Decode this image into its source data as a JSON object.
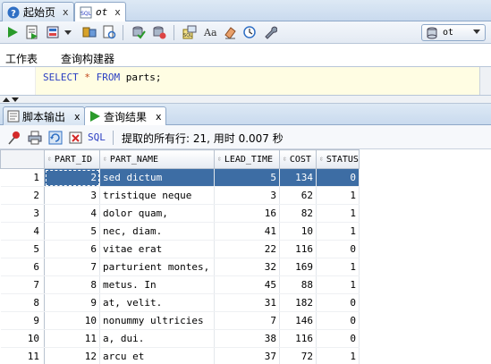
{
  "doc_tabs": [
    {
      "label": "起始页",
      "close": "x"
    },
    {
      "label": "ot",
      "close": "x"
    }
  ],
  "connection": {
    "value": "ot"
  },
  "editor_tabs": [
    {
      "label": "工作表"
    },
    {
      "label": "查询构建器"
    }
  ],
  "editor": {
    "sql_keyword_1": "SELECT",
    "sql_star": "*",
    "sql_keyword_2": "FROM",
    "sql_rest": "parts;"
  },
  "panel_tabs": [
    {
      "label": "脚本输出",
      "close": "x"
    },
    {
      "label": "查询结果",
      "close": "x"
    }
  ],
  "results_toolbar": {
    "sql_link": "SQL",
    "sep": "|",
    "status": "提取的所有行: 21, 用时 0.007 秒"
  },
  "results": {
    "columns": [
      "PART_ID",
      "PART_NAME",
      "LEAD_TIME",
      "COST",
      "STATUS"
    ],
    "rows": [
      {
        "rn": "1",
        "part_id": "2",
        "part_name": "sed dictum",
        "lead_time": "5",
        "cost": "134",
        "status": "0"
      },
      {
        "rn": "2",
        "part_id": "3",
        "part_name": "tristique neque",
        "lead_time": "3",
        "cost": "62",
        "status": "1"
      },
      {
        "rn": "3",
        "part_id": "4",
        "part_name": "dolor quam,",
        "lead_time": "16",
        "cost": "82",
        "status": "1"
      },
      {
        "rn": "4",
        "part_id": "5",
        "part_name": "nec, diam.",
        "lead_time": "41",
        "cost": "10",
        "status": "1"
      },
      {
        "rn": "5",
        "part_id": "6",
        "part_name": "vitae erat",
        "lead_time": "22",
        "cost": "116",
        "status": "0"
      },
      {
        "rn": "6",
        "part_id": "7",
        "part_name": "parturient montes,",
        "lead_time": "32",
        "cost": "169",
        "status": "1"
      },
      {
        "rn": "7",
        "part_id": "8",
        "part_name": "metus. In",
        "lead_time": "45",
        "cost": "88",
        "status": "1"
      },
      {
        "rn": "8",
        "part_id": "9",
        "part_name": "at, velit.",
        "lead_time": "31",
        "cost": "182",
        "status": "0"
      },
      {
        "rn": "9",
        "part_id": "10",
        "part_name": "nonummy ultricies",
        "lead_time": "7",
        "cost": "146",
        "status": "0"
      },
      {
        "rn": "10",
        "part_id": "11",
        "part_name": "a, dui.",
        "lead_time": "38",
        "cost": "116",
        "status": "0"
      },
      {
        "rn": "11",
        "part_id": "12",
        "part_name": "arcu et",
        "lead_time": "37",
        "cost": "72",
        "status": "1"
      }
    ],
    "selected_row": 0
  }
}
